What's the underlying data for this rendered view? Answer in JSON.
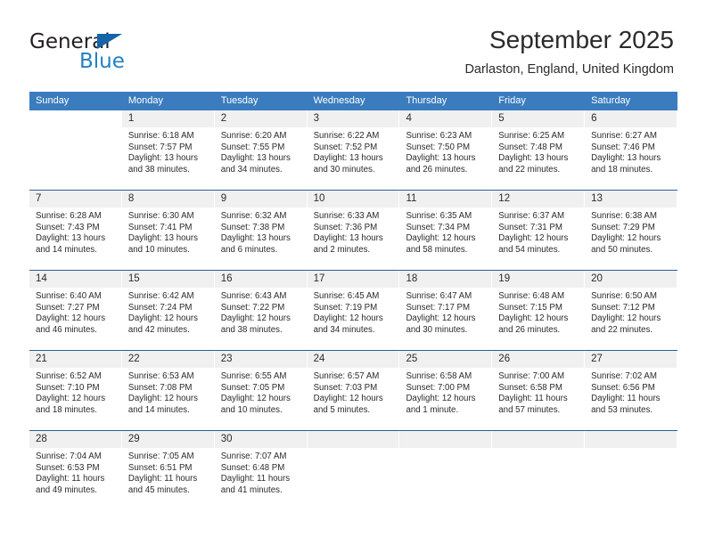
{
  "brand": {
    "name_part1": "General",
    "name_part2": "Blue",
    "accent_color": "#2280c4",
    "triangle_color": "#1565a8"
  },
  "header": {
    "title": "September 2025",
    "subtitle": "Darlaston, England, United Kingdom",
    "header_bg_color": "#3a7cbe",
    "week_divider_color": "#2a6099",
    "daynum_band_color": "#f0f0f0"
  },
  "weekday_headers": [
    "Sunday",
    "Monday",
    "Tuesday",
    "Wednesday",
    "Thursday",
    "Friday",
    "Saturday"
  ],
  "weeks": [
    [
      {
        "day": "",
        "blank": true,
        "lead": true
      },
      {
        "day": "1",
        "sunrise": "Sunrise: 6:18 AM",
        "sunset": "Sunset: 7:57 PM",
        "daylight1": "Daylight: 13 hours",
        "daylight2": "and 38 minutes."
      },
      {
        "day": "2",
        "sunrise": "Sunrise: 6:20 AM",
        "sunset": "Sunset: 7:55 PM",
        "daylight1": "Daylight: 13 hours",
        "daylight2": "and 34 minutes."
      },
      {
        "day": "3",
        "sunrise": "Sunrise: 6:22 AM",
        "sunset": "Sunset: 7:52 PM",
        "daylight1": "Daylight: 13 hours",
        "daylight2": "and 30 minutes."
      },
      {
        "day": "4",
        "sunrise": "Sunrise: 6:23 AM",
        "sunset": "Sunset: 7:50 PM",
        "daylight1": "Daylight: 13 hours",
        "daylight2": "and 26 minutes."
      },
      {
        "day": "5",
        "sunrise": "Sunrise: 6:25 AM",
        "sunset": "Sunset: 7:48 PM",
        "daylight1": "Daylight: 13 hours",
        "daylight2": "and 22 minutes."
      },
      {
        "day": "6",
        "sunrise": "Sunrise: 6:27 AM",
        "sunset": "Sunset: 7:46 PM",
        "daylight1": "Daylight: 13 hours",
        "daylight2": "and 18 minutes."
      }
    ],
    [
      {
        "day": "7",
        "sunrise": "Sunrise: 6:28 AM",
        "sunset": "Sunset: 7:43 PM",
        "daylight1": "Daylight: 13 hours",
        "daylight2": "and 14 minutes."
      },
      {
        "day": "8",
        "sunrise": "Sunrise: 6:30 AM",
        "sunset": "Sunset: 7:41 PM",
        "daylight1": "Daylight: 13 hours",
        "daylight2": "and 10 minutes."
      },
      {
        "day": "9",
        "sunrise": "Sunrise: 6:32 AM",
        "sunset": "Sunset: 7:38 PM",
        "daylight1": "Daylight: 13 hours",
        "daylight2": "and 6 minutes."
      },
      {
        "day": "10",
        "sunrise": "Sunrise: 6:33 AM",
        "sunset": "Sunset: 7:36 PM",
        "daylight1": "Daylight: 13 hours",
        "daylight2": "and 2 minutes."
      },
      {
        "day": "11",
        "sunrise": "Sunrise: 6:35 AM",
        "sunset": "Sunset: 7:34 PM",
        "daylight1": "Daylight: 12 hours",
        "daylight2": "and 58 minutes."
      },
      {
        "day": "12",
        "sunrise": "Sunrise: 6:37 AM",
        "sunset": "Sunset: 7:31 PM",
        "daylight1": "Daylight: 12 hours",
        "daylight2": "and 54 minutes."
      },
      {
        "day": "13",
        "sunrise": "Sunrise: 6:38 AM",
        "sunset": "Sunset: 7:29 PM",
        "daylight1": "Daylight: 12 hours",
        "daylight2": "and 50 minutes."
      }
    ],
    [
      {
        "day": "14",
        "sunrise": "Sunrise: 6:40 AM",
        "sunset": "Sunset: 7:27 PM",
        "daylight1": "Daylight: 12 hours",
        "daylight2": "and 46 minutes."
      },
      {
        "day": "15",
        "sunrise": "Sunrise: 6:42 AM",
        "sunset": "Sunset: 7:24 PM",
        "daylight1": "Daylight: 12 hours",
        "daylight2": "and 42 minutes."
      },
      {
        "day": "16",
        "sunrise": "Sunrise: 6:43 AM",
        "sunset": "Sunset: 7:22 PM",
        "daylight1": "Daylight: 12 hours",
        "daylight2": "and 38 minutes."
      },
      {
        "day": "17",
        "sunrise": "Sunrise: 6:45 AM",
        "sunset": "Sunset: 7:19 PM",
        "daylight1": "Daylight: 12 hours",
        "daylight2": "and 34 minutes."
      },
      {
        "day": "18",
        "sunrise": "Sunrise: 6:47 AM",
        "sunset": "Sunset: 7:17 PM",
        "daylight1": "Daylight: 12 hours",
        "daylight2": "and 30 minutes."
      },
      {
        "day": "19",
        "sunrise": "Sunrise: 6:48 AM",
        "sunset": "Sunset: 7:15 PM",
        "daylight1": "Daylight: 12 hours",
        "daylight2": "and 26 minutes."
      },
      {
        "day": "20",
        "sunrise": "Sunrise: 6:50 AM",
        "sunset": "Sunset: 7:12 PM",
        "daylight1": "Daylight: 12 hours",
        "daylight2": "and 22 minutes."
      }
    ],
    [
      {
        "day": "21",
        "sunrise": "Sunrise: 6:52 AM",
        "sunset": "Sunset: 7:10 PM",
        "daylight1": "Daylight: 12 hours",
        "daylight2": "and 18 minutes."
      },
      {
        "day": "22",
        "sunrise": "Sunrise: 6:53 AM",
        "sunset": "Sunset: 7:08 PM",
        "daylight1": "Daylight: 12 hours",
        "daylight2": "and 14 minutes."
      },
      {
        "day": "23",
        "sunrise": "Sunrise: 6:55 AM",
        "sunset": "Sunset: 7:05 PM",
        "daylight1": "Daylight: 12 hours",
        "daylight2": "and 10 minutes."
      },
      {
        "day": "24",
        "sunrise": "Sunrise: 6:57 AM",
        "sunset": "Sunset: 7:03 PM",
        "daylight1": "Daylight: 12 hours",
        "daylight2": "and 5 minutes."
      },
      {
        "day": "25",
        "sunrise": "Sunrise: 6:58 AM",
        "sunset": "Sunset: 7:00 PM",
        "daylight1": "Daylight: 12 hours",
        "daylight2": "and 1 minute."
      },
      {
        "day": "26",
        "sunrise": "Sunrise: 7:00 AM",
        "sunset": "Sunset: 6:58 PM",
        "daylight1": "Daylight: 11 hours",
        "daylight2": "and 57 minutes."
      },
      {
        "day": "27",
        "sunrise": "Sunrise: 7:02 AM",
        "sunset": "Sunset: 6:56 PM",
        "daylight1": "Daylight: 11 hours",
        "daylight2": "and 53 minutes."
      }
    ],
    [
      {
        "day": "28",
        "sunrise": "Sunrise: 7:04 AM",
        "sunset": "Sunset: 6:53 PM",
        "daylight1": "Daylight: 11 hours",
        "daylight2": "and 49 minutes."
      },
      {
        "day": "29",
        "sunrise": "Sunrise: 7:05 AM",
        "sunset": "Sunset: 6:51 PM",
        "daylight1": "Daylight: 11 hours",
        "daylight2": "and 45 minutes."
      },
      {
        "day": "30",
        "sunrise": "Sunrise: 7:07 AM",
        "sunset": "Sunset: 6:48 PM",
        "daylight1": "Daylight: 11 hours",
        "daylight2": "and 41 minutes."
      },
      {
        "day": "",
        "blank": true
      },
      {
        "day": "",
        "blank": true
      },
      {
        "day": "",
        "blank": true
      },
      {
        "day": "",
        "blank": true
      }
    ]
  ]
}
